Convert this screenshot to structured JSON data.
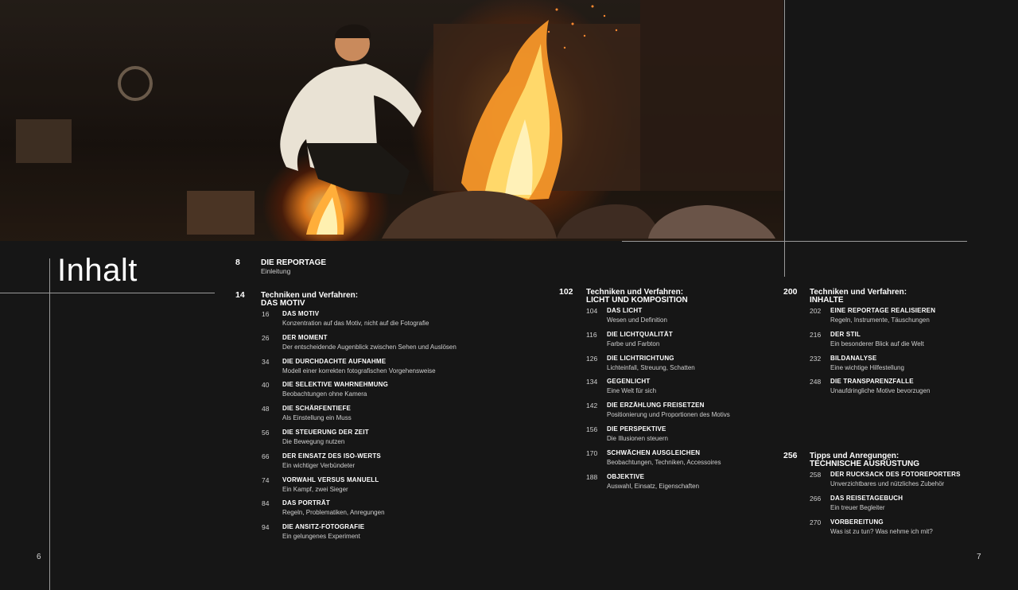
{
  "title": "Inhalt",
  "page_left": "6",
  "page_right": "7",
  "intro": {
    "num": "8",
    "title": "DIE REPORTAGE",
    "sub": "Einleitung"
  },
  "sections": [
    {
      "num": "14",
      "title1": "Techniken und Verfahren:",
      "title2": "DAS MOTIV",
      "items": [
        {
          "n": "16",
          "t": "DAS MOTIV",
          "s": "Konzentration auf das Motiv, nicht auf die Fotografie"
        },
        {
          "n": "26",
          "t": "DER MOMENT",
          "s": "Der entscheidende Augenblick zwischen Sehen und Auslösen"
        },
        {
          "n": "34",
          "t": "DIE DURCHDACHTE AUFNAHME",
          "s": "Modell einer korrekten fotografischen Vorgehensweise"
        },
        {
          "n": "40",
          "t": "DIE SELEKTIVE WAHRNEHMUNG",
          "s": "Beobachtungen ohne Kamera"
        },
        {
          "n": "48",
          "t": "DIE SCHÄRFENTIEFE",
          "s": "Als Einstellung ein Muss"
        },
        {
          "n": "56",
          "t": "DIE STEUERUNG DER ZEIT",
          "s": "Die Bewegung nutzen"
        },
        {
          "n": "66",
          "t": "DER EINSATZ DES ISO-WERTS",
          "s": "Ein wichtiger Verbündeter"
        },
        {
          "n": "74",
          "t": "VORWAHL VERSUS MANUELL",
          "s": "Ein Kampf, zwei Sieger"
        },
        {
          "n": "84",
          "t": "DAS PORTRÄT",
          "s": "Regeln, Problematiken, Anregungen"
        },
        {
          "n": "94",
          "t": "DIE ANSITZ-FOTOGRAFIE",
          "s": "Ein gelungenes Experiment"
        }
      ]
    },
    {
      "num": "102",
      "title1": "Techniken und Verfahren:",
      "title2": "LICHT UND KOMPOSITION",
      "items": [
        {
          "n": "104",
          "t": "DAS LICHT",
          "s": "Wesen und Definition"
        },
        {
          "n": "116",
          "t": "DIE LICHTQUALITÄT",
          "s": "Farbe und Farbton"
        },
        {
          "n": "126",
          "t": "DIE LICHTRICHTUNG",
          "s": "Lichteinfall, Streuung, Schatten"
        },
        {
          "n": "134",
          "t": "GEGENLICHT",
          "s": "Eine Welt für sich"
        },
        {
          "n": "142",
          "t": "DIE ERZÄHLUNG FREISETZEN",
          "s": "Positionierung und Proportionen des Motivs"
        },
        {
          "n": "156",
          "t": "DIE PERSPEKTIVE",
          "s": "Die Illusionen steuern"
        },
        {
          "n": "170",
          "t": "SCHWÄCHEN AUSGLEICHEN",
          "s": "Beobachtungen, Techniken, Accessoires"
        },
        {
          "n": "188",
          "t": "OBJEKTIVE",
          "s": "Auswahl, Einsatz, Eigenschaften"
        }
      ]
    },
    {
      "num": "200",
      "title1": "Techniken und Verfahren:",
      "title2": "INHALTE",
      "items": [
        {
          "n": "202",
          "t": "EINE REPORTAGE REALISIEREN",
          "s": "Regeln, Instrumente, Täuschungen"
        },
        {
          "n": "216",
          "t": "DER STIL",
          "s": "Ein besonderer Blick auf die Welt"
        },
        {
          "n": "232",
          "t": "BILDANALYSE",
          "s": "Eine wichtige Hilfestellung"
        },
        {
          "n": "248",
          "t": "DIE TRANSPARENZFALLE",
          "s": "Unaufdringliche Motive bevorzugen"
        }
      ]
    },
    {
      "num": "256",
      "title1": "Tipps und Anregungen:",
      "title2": "TECHNISCHE AUSRÜSTUNG",
      "items": [
        {
          "n": "258",
          "t": "DER RUCKSACK DES FOTOREPORTERS",
          "s": "Unverzichtbares und nützliches Zubehör"
        },
        {
          "n": "266",
          "t": "DAS REISETAGEBUCH",
          "s": "Ein treuer Begleiter"
        },
        {
          "n": "270",
          "t": "VORBEREITUNG",
          "s": "Was ist zu tun? Was nehme ich mit?"
        }
      ]
    }
  ]
}
